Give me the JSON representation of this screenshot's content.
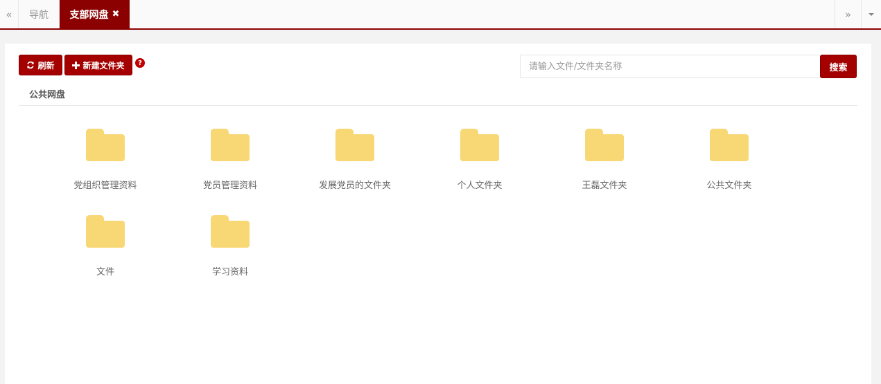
{
  "tabbar": {
    "scroll_left_glyph": "«",
    "scroll_right_glyph": "»",
    "tabs": [
      {
        "label": "导航"
      },
      {
        "label": "支部网盘",
        "close_glyph": "✖"
      }
    ],
    "accent_color": "#8b0000"
  },
  "toolbar": {
    "refresh_icon": "refresh-icon",
    "refresh_label": "刷新",
    "new_folder_icon": "plus-icon",
    "new_folder_label": "新建文件夹",
    "help_glyph": "?",
    "search_placeholder": "请输入文件/文件夹名称",
    "search_value": "",
    "search_label": "搜索"
  },
  "section": {
    "title": "公共网盘"
  },
  "folders": [
    {
      "name": "党组织管理资料"
    },
    {
      "name": "党员管理资料"
    },
    {
      "name": "发展党员的文件夹"
    },
    {
      "name": "个人文件夹"
    },
    {
      "name": "王磊文件夹"
    },
    {
      "name": "公共文件夹"
    },
    {
      "name": "文件"
    },
    {
      "name": "学习资料"
    }
  ],
  "colors": {
    "button": "#a40000",
    "folder": "#f8d775"
  }
}
